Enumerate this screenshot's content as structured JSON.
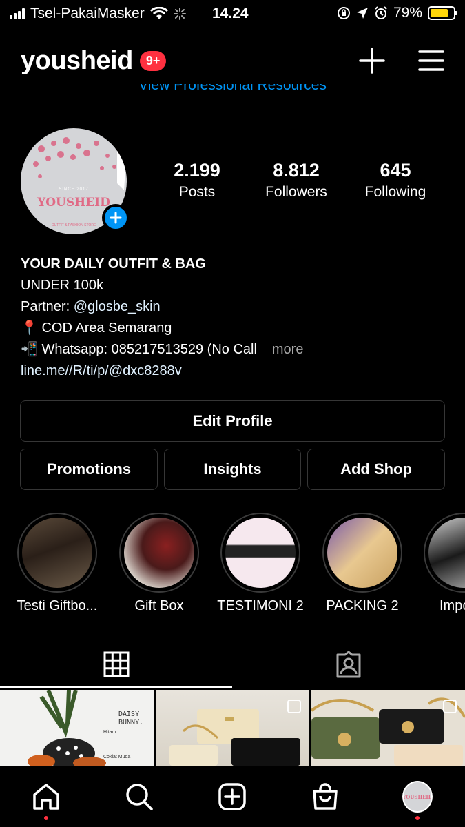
{
  "status_bar": {
    "carrier": "Tsel-PakaiMasker",
    "time": "14.24",
    "battery": "79%",
    "battery_level": 0.79
  },
  "header": {
    "username": "yousheid",
    "notification_badge": "9+",
    "pro_resources_link": "View Professional Resources"
  },
  "profile": {
    "avatar": {
      "since": "SINCE 2017",
      "brand": "YOUSHEID",
      "tagline": "OUTFIT & FASHION STORE"
    },
    "stats": [
      {
        "value": "2.199",
        "label": "Posts"
      },
      {
        "value": "8.812",
        "label": "Followers"
      },
      {
        "value": "645",
        "label": "Following"
      }
    ],
    "bio": {
      "name": "YOUR DAILY OUTFIT & BAG",
      "line1": "UNDER 100k",
      "partner_prefix": "Partner: ",
      "partner_handle": "@glosbe_skin",
      "line3": "📍 COD Area Semarang",
      "line4": "📲 Whatsapp: 085217513529 (No Call",
      "more": "more",
      "link": "line.me//R/ti/p/@dxc8288v"
    }
  },
  "buttons": {
    "edit_profile": "Edit Profile",
    "promotions": "Promotions",
    "insights": "Insights",
    "add_shop": "Add Shop"
  },
  "highlights": [
    {
      "label": "Testi Giftbo...",
      "color": "#3b2a22"
    },
    {
      "label": "Gift Box",
      "color": "#5a2a2a"
    },
    {
      "label": "TESTIMONI 2",
      "color": "#f3e3ea"
    },
    {
      "label": "PACKING 2",
      "color": "#8a6ab0"
    },
    {
      "label": "ImportS",
      "color": "#2a2a2a"
    }
  ],
  "tabs": [
    {
      "name": "grid-icon"
    },
    {
      "name": "tagged-icon"
    }
  ],
  "posts": [
    {
      "caption": "DAISY BUNNY.",
      "note1": "Hitam",
      "note2": "Coklat Muda"
    },
    {
      "caption": ""
    },
    {
      "caption": ""
    }
  ],
  "nav": {
    "avatar_text": "YOUSHEID"
  },
  "colors": {
    "accent_blue": "#0095f6",
    "badge_red": "#ff3040",
    "battery_yellow": "#ffd60a"
  }
}
